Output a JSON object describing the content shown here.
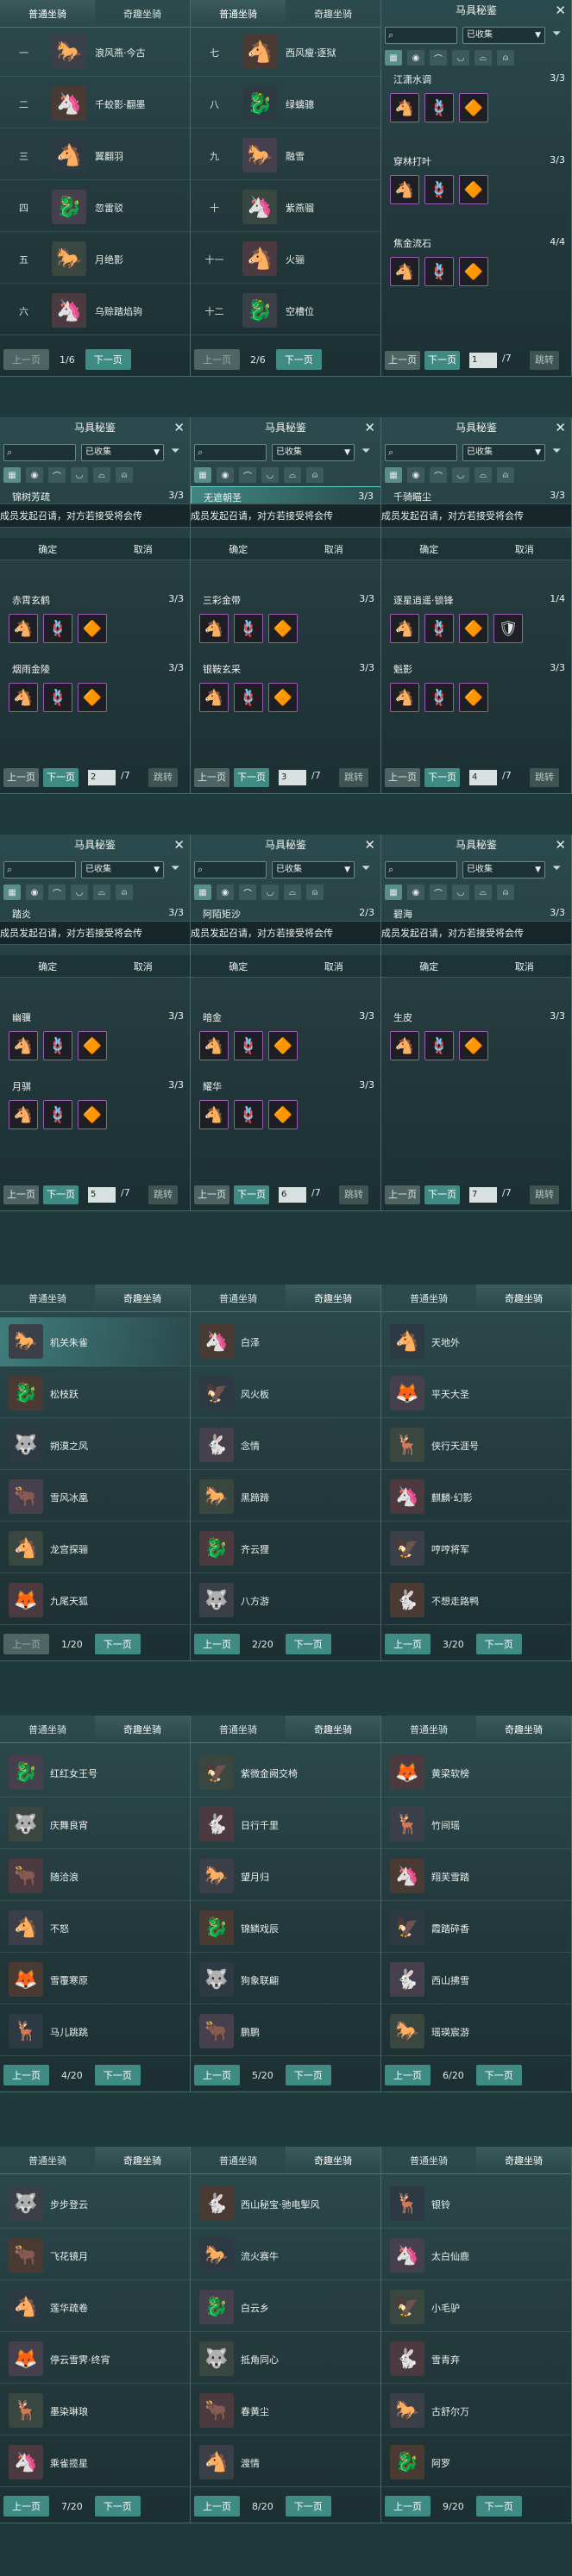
{
  "tabs": {
    "normal": "普通坐骑",
    "fun": "奇趣坐骑"
  },
  "pager": {
    "prev": "上一页",
    "next": "下一页",
    "jump": "跳转"
  },
  "book": {
    "title": "马具秘鉴",
    "close": "✕",
    "filter_value": "已收集",
    "confirm": "确定",
    "cancel": "取消",
    "banner": "成员发起召请，对方若接受将会传"
  },
  "normal_pages": [
    {
      "page": "1/6",
      "rows": [
        {
          "num": "一",
          "name": "浪风燕·今古",
          "icon": "horse-icon"
        },
        {
          "num": "二",
          "name": "千蛟影·翻墨",
          "icon": "horse-icon"
        },
        {
          "num": "三",
          "name": "翼翻羽",
          "icon": "horse-icon"
        },
        {
          "num": "四",
          "name": "忽雷驳",
          "icon": "horse-icon"
        },
        {
          "num": "五",
          "name": "月绝影",
          "icon": "horse-icon"
        },
        {
          "num": "六",
          "name": "乌赊踏焰驹",
          "icon": "horse-icon"
        }
      ]
    },
    {
      "page": "2/6",
      "rows": [
        {
          "num": "七",
          "name": "西风瘦·逐狱",
          "icon": "horse-icon"
        },
        {
          "num": "八",
          "name": "绿螭骢",
          "icon": "horse-icon"
        },
        {
          "num": "九",
          "name": "融雪",
          "icon": "horse-icon"
        },
        {
          "num": "十",
          "name": "紫燕骝",
          "icon": "horse-icon"
        },
        {
          "num": "十一",
          "name": "火骊",
          "icon": "horse-icon"
        },
        {
          "num": "十二",
          "name": "空槽位",
          "icon": "horse-icon"
        }
      ]
    }
  ],
  "book_pages": [
    {
      "page_input": "1",
      "total": "/7",
      "sets": [
        {
          "name": "江潇水调",
          "count": "3/3"
        },
        {
          "name": "穿林打叶",
          "count": "3/3"
        },
        {
          "name": "焦金流石",
          "count": "4/4"
        }
      ]
    },
    {
      "page_input": "2",
      "total": "/7",
      "sets": [
        {
          "name": "锦树芳疏",
          "count": "3/3"
        },
        {
          "name": "赤霄玄鹤",
          "count": "3/3"
        },
        {
          "name": "烟雨金陵",
          "count": "3/3"
        }
      ]
    },
    {
      "page_input": "3",
      "total": "/7",
      "sets": [
        {
          "name": "无遮朝圣",
          "count": "3/3"
        },
        {
          "name": "三彩金带",
          "count": "3/3"
        },
        {
          "name": "银鞍玄采",
          "count": "3/3"
        }
      ]
    },
    {
      "page_input": "4",
      "total": "/7",
      "sets": [
        {
          "name": "千骑瞄尘",
          "count": "3/3"
        },
        {
          "name": "逐星逍遥·锁锋",
          "count": "1/4"
        },
        {
          "name": "魁影",
          "count": "3/3"
        }
      ]
    },
    {
      "page_input": "5",
      "total": "/7",
      "sets": [
        {
          "name": "踏炎",
          "count": "3/3"
        },
        {
          "name": "幽骥",
          "count": "3/3"
        },
        {
          "name": "月骐",
          "count": "3/3"
        }
      ]
    },
    {
      "page_input": "6",
      "total": "/7",
      "sets": [
        {
          "name": "阿陌矩沙",
          "count": "2/3"
        },
        {
          "name": "暗金",
          "count": "3/3"
        },
        {
          "name": "耀华",
          "count": "3/3"
        }
      ]
    },
    {
      "page_input": "7",
      "total": "/7",
      "sets": [
        {
          "name": "碧海",
          "count": "3/3"
        },
        {
          "name": "生皮",
          "count": "3/3"
        }
      ]
    }
  ],
  "fun_pages": [
    {
      "page": "1/20",
      "rows": [
        "机关朱雀",
        "松枝跃",
        "朔漠之风",
        "雪风冰凰",
        "龙宫探骊",
        "九尾天狐"
      ]
    },
    {
      "page": "2/20",
      "rows": [
        "白泽",
        "风火板",
        "念情",
        "黑蹄蹄",
        "齐云狸",
        "八方游"
      ]
    },
    {
      "page": "3/20",
      "rows": [
        "天地外",
        "平天大圣",
        "侠行天涯号",
        "麒麟·幻影",
        "哼哼将军",
        "不想走路鸭"
      ]
    },
    {
      "page": "4/20",
      "rows": [
        "红红女王号",
        "庆舞良宵",
        "随洽浪",
        "不怒",
        "雪覆寒原",
        "马儿跳跳"
      ]
    },
    {
      "page": "5/20",
      "rows": [
        "紫微金阙交椅",
        "日行千里",
        "望月归",
        "锦鳞戏辰",
        "狗象联翩",
        "鹏鹏"
      ]
    },
    {
      "page": "6/20",
      "rows": [
        "黄梁软榜",
        "竹间瑶",
        "翔芙雪踏",
        "霞踏碎香",
        "西山拂雪",
        "瑶瑛宸游"
      ]
    },
    {
      "page": "7/20",
      "rows": [
        "步步登云",
        "飞花镜月",
        "莲华疏卷",
        "停云雪霁·终宵",
        "墨染琳琅",
        "乘雀揽星"
      ]
    },
    {
      "page": "8/20",
      "rows": [
        "西山秘宝·驰电掣风",
        "流火赛牛",
        "白云乡",
        "抵角同心",
        "春黄尘",
        "渡情"
      ]
    },
    {
      "page": "9/20",
      "rows": [
        "银铃",
        "太白仙鹿",
        "小毛驴",
        "雪青弃",
        "古舒尔万",
        "阿罗"
      ]
    }
  ],
  "colors": {
    "accent": "#3f8a83",
    "panel": "#27403f",
    "quality_border": "#9b5ab4"
  }
}
